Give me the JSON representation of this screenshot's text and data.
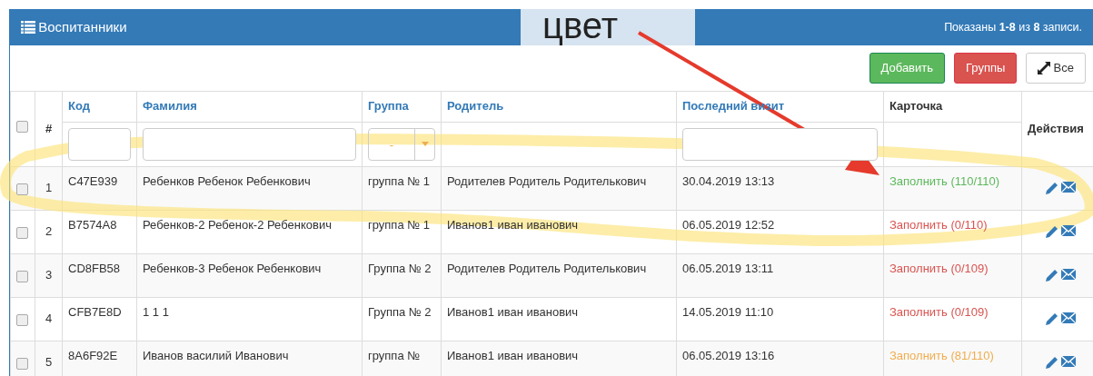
{
  "panel": {
    "title": "Воспитанники",
    "summary": "Показаны **1-8** из **8** записи."
  },
  "annotation": {
    "label": "цвет"
  },
  "toolbar": [
    {
      "label": "Добавить",
      "kind": "success"
    },
    {
      "label": "Группы",
      "kind": "danger"
    },
    {
      "label": "Все",
      "kind": "expand"
    }
  ],
  "table": {
    "columns": [
      {
        "label": "#",
        "kind": "plain"
      },
      {
        "label": "Код",
        "kind": "text"
      },
      {
        "label": "Фамилия",
        "kind": "text"
      },
      {
        "label": "Группа",
        "kind": "select"
      },
      {
        "label": "Родитель",
        "kind": "none"
      },
      {
        "label": "Последний визит",
        "kind": "text"
      },
      {
        "label": "Карточка",
        "kind": "plain"
      },
      {
        "label": "Действия",
        "kind": "actions"
      }
    ],
    "group_filter": {
      "value": "-"
    },
    "all_checked": false,
    "rows": [
      {
        "number": "1",
        "code": "C47E939",
        "name": "Ребенков Ребенок Ребенкович",
        "group": "группа № 1",
        "parent": "Родителев Родитель Родителькович",
        "visit": "30.04.2019 13:13",
        "card": "Заполнить (110/110)",
        "color": "#5cb85c",
        "checked": false
      },
      {
        "number": "2",
        "code": "B7574A8",
        "name": "Ребенков-2 Ребенок-2 Ребенкович",
        "group": "группа № 1",
        "parent": "Иванов1 иван иванович",
        "visit": "06.05.2019 12:52",
        "card": "Заполнить (0/110)",
        "color": "#d9534f",
        "checked": false
      },
      {
        "number": "3",
        "code": "CD8FB58",
        "name": "Ребенков-3 Ребенок Ребенкович",
        "group": "Группа № 2",
        "parent": "Родителев Родитель Родителькович",
        "visit": "06.05.2019 13:11",
        "card": "Заполнить (0/109)",
        "color": "#d9534f",
        "checked": false
      },
      {
        "number": "4",
        "code": "CFB7E8D",
        "name": "1 1 1",
        "group": "Группа № 2",
        "parent": "Иванов1 иван иванович",
        "visit": "14.05.2019 11:10",
        "card": "Заполнить (0/109)",
        "color": "#d9534f",
        "checked": false
      },
      {
        "number": "5",
        "code": "8A6F92E",
        "name": "Иванов василий Иванович",
        "group": "группа №",
        "parent": "Иванов1 иван иванович",
        "visit": "06.05.2019 13:16",
        "card": "Заполнить (81/110)",
        "color": "#f0ad4e",
        "checked": false
      }
    ]
  }
}
